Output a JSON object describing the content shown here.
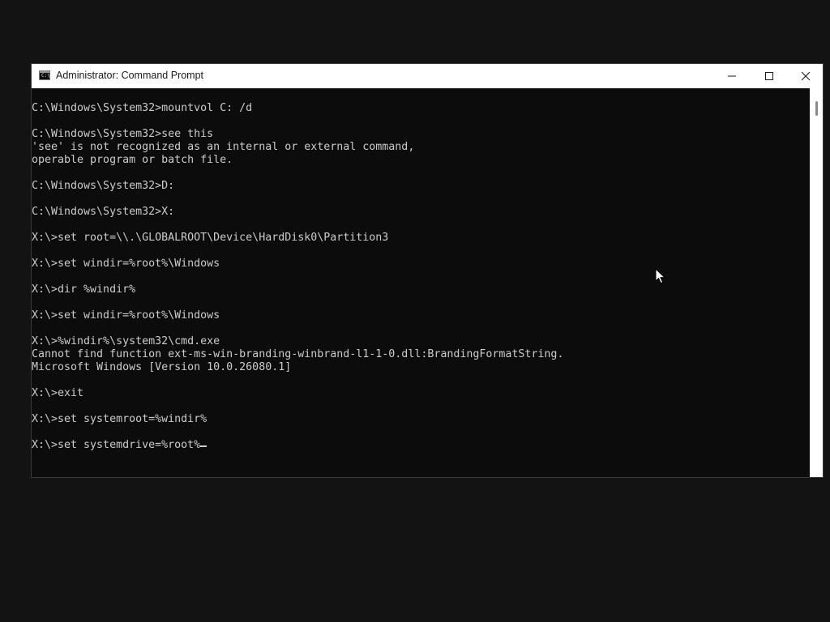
{
  "window": {
    "title": "Administrator: Command Prompt",
    "icon": "cmd-icon",
    "icon_glyph": "C:\\.",
    "controls": [
      "minimize-icon",
      "maximize-icon",
      "close-icon"
    ]
  },
  "console": {
    "lines": [
      "C:\\Windows\\System32>mountvol C: /d",
      "",
      "C:\\Windows\\System32>see this",
      "'see' is not recognized as an internal or external command,",
      "operable program or batch file.",
      "",
      "C:\\Windows\\System32>D:",
      "",
      "C:\\Windows\\System32>X:",
      "",
      "X:\\>set root=\\\\.\\GLOBALROOT\\Device\\HardDisk0\\Partition3",
      "",
      "X:\\>set windir=%root%\\Windows",
      "",
      "X:\\>dir %windir%",
      "",
      "X:\\>set windir=%root%\\Windows",
      "",
      "X:\\>%windir%\\system32\\cmd.exe",
      "Cannot find function ext-ms-win-branding-winbrand-l1-1-0.dll:BrandingFormatString.",
      "Microsoft Windows [Version 10.0.26080.1]",
      "",
      "X:\\>exit",
      "",
      "X:\\>set systemroot=%windir%",
      "",
      "X:\\>set systemdrive=%root%"
    ]
  },
  "colors": {
    "console_background": "#0c0c0c",
    "console_text": "#cccccc",
    "titlebar_background": "#ffffff",
    "desktop_background": "#131313"
  }
}
